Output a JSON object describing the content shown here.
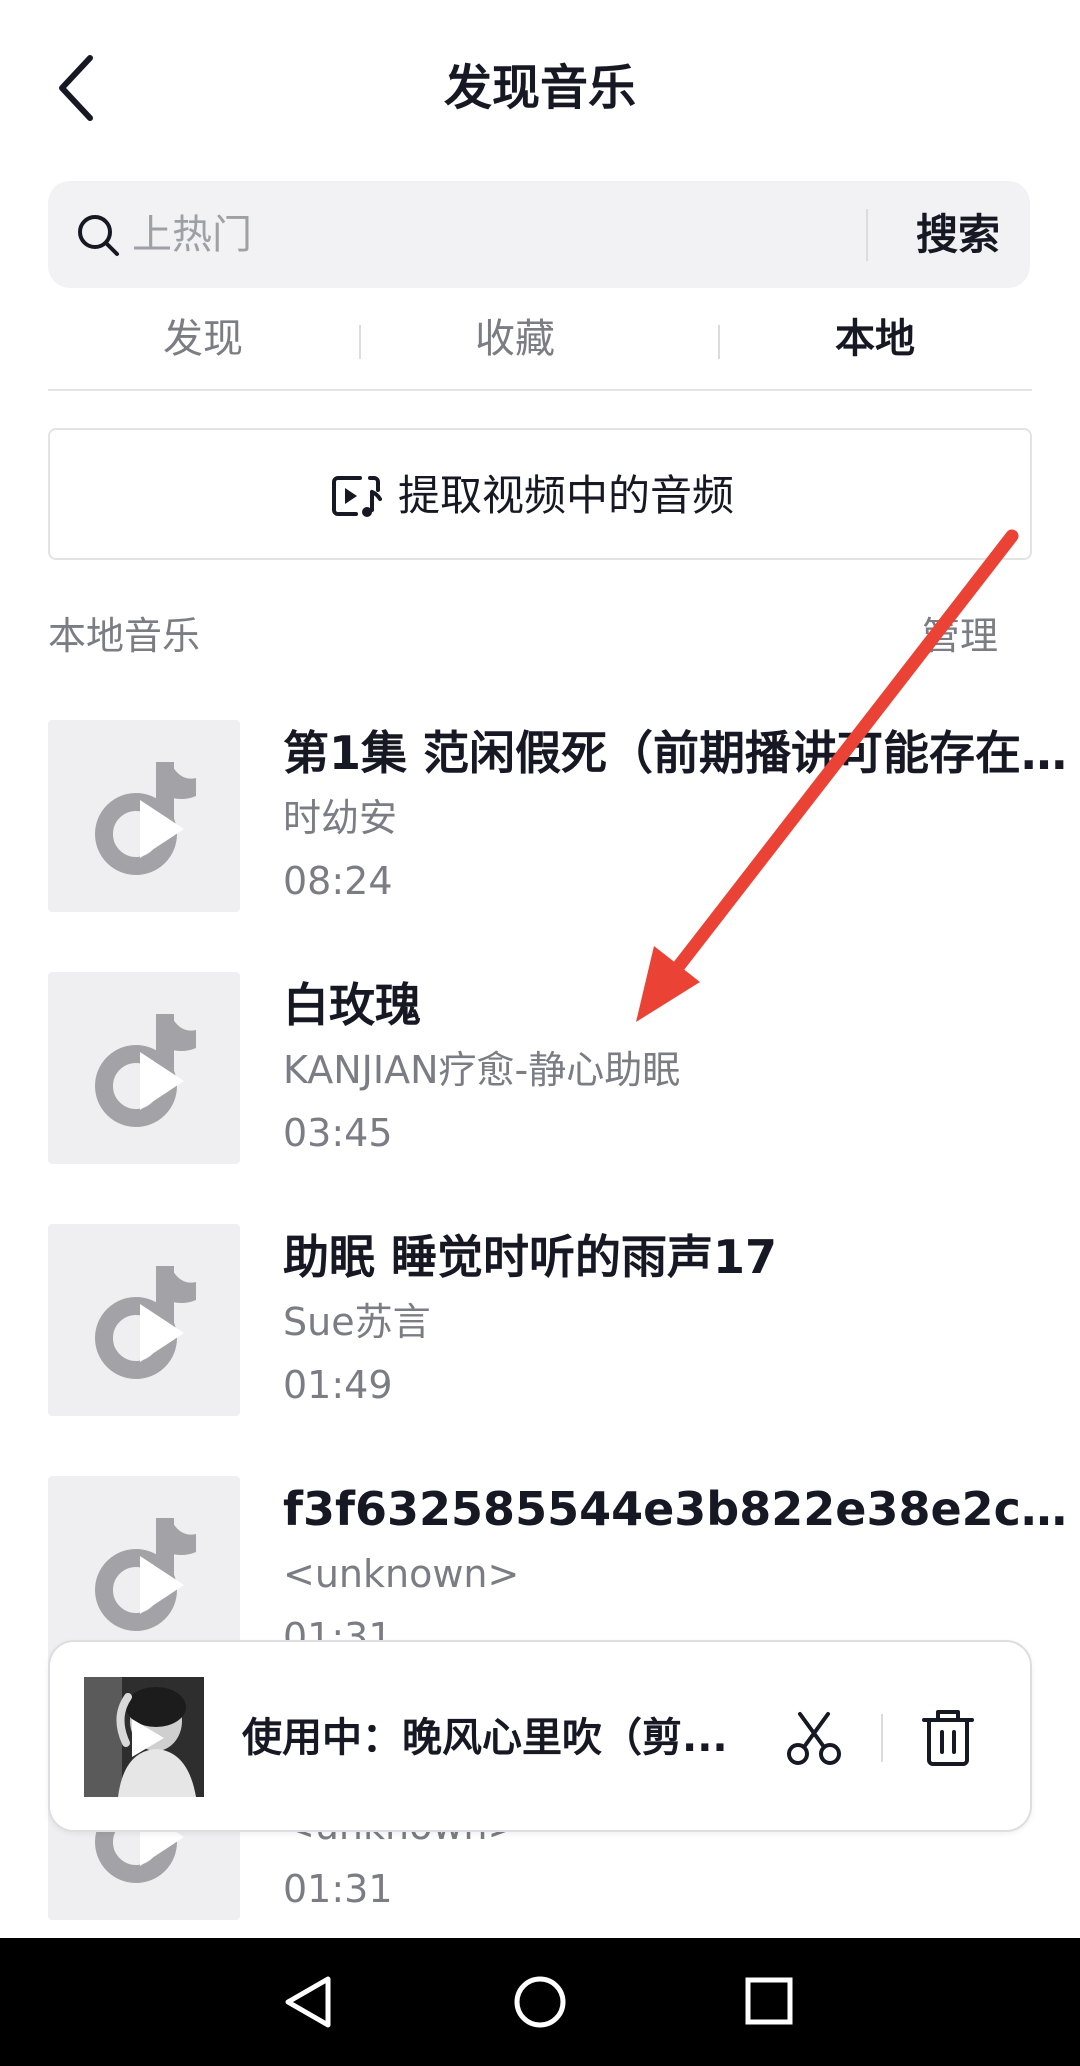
{
  "header": {
    "title": "发现音乐"
  },
  "search": {
    "placeholder": "上热门",
    "button_label": "搜索"
  },
  "tabs": [
    {
      "label": "发现",
      "active": false
    },
    {
      "label": "收藏",
      "active": false
    },
    {
      "label": "本地",
      "active": true
    }
  ],
  "extract": {
    "label": "提取视频中的音频"
  },
  "section": {
    "title": "本地音乐",
    "manage_label": "管理"
  },
  "tracks": [
    {
      "title": "第1集 范闲假死（前期播讲可能存在一...",
      "artist": "时幼安",
      "duration": "08:24"
    },
    {
      "title": "白玫瑰",
      "artist": "KANJIAN疗愈-静心助眠",
      "duration": "03:45"
    },
    {
      "title": "助眠 睡觉时听的雨声17",
      "artist": "Sue苏言",
      "duration": "01:49"
    },
    {
      "title": "f3f632585544e3b822e38e2c3460...",
      "artist": "<unknown>",
      "duration": "01:31"
    },
    {
      "title": "...",
      "artist": "<unknown>",
      "duration": "01:31"
    }
  ],
  "now_playing": {
    "text": "使用中：晚风心里吹（剪..."
  },
  "colors": {
    "accent_arrow": "#ea4335",
    "text_primary": "#161823",
    "text_secondary": "#7b7c84",
    "cover_bg": "#efeff1"
  },
  "icons": [
    "back-arrow-icon",
    "search-icon",
    "video-music-icon",
    "music-note-icon",
    "play-icon",
    "scissors-icon",
    "trash-icon",
    "nav-back-icon",
    "nav-home-icon",
    "nav-recents-icon"
  ]
}
